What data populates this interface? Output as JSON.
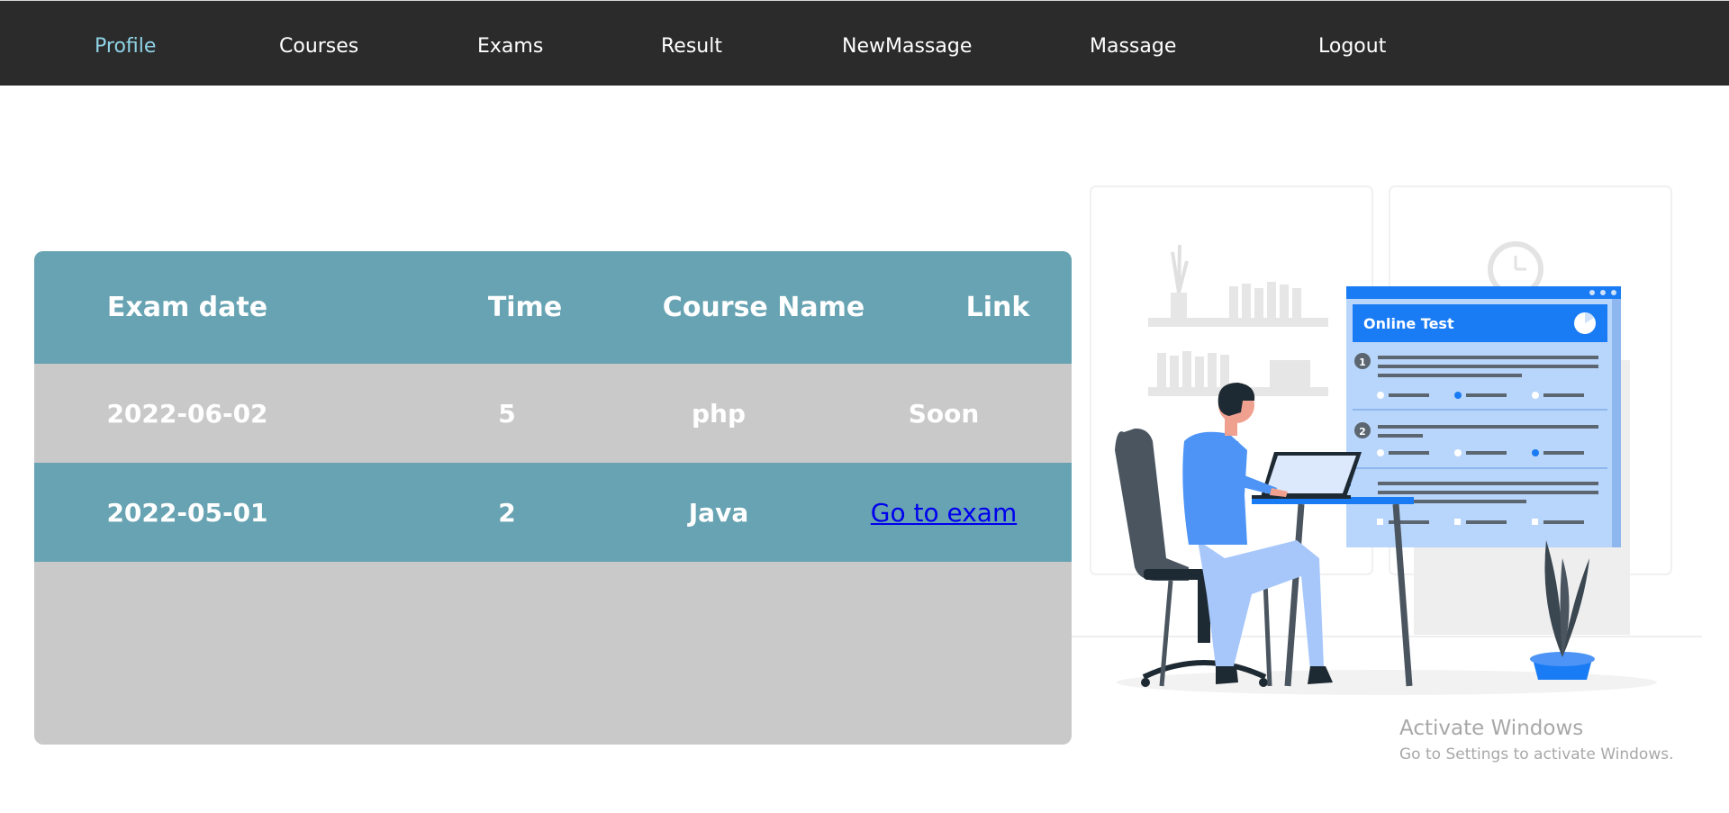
{
  "nav": {
    "items": [
      {
        "label": "Profile",
        "active": true
      },
      {
        "label": "Courses"
      },
      {
        "label": "Exams"
      },
      {
        "label": "Result"
      },
      {
        "label": "NewMassage"
      },
      {
        "label": "Massage"
      },
      {
        "label": "Logout"
      }
    ]
  },
  "exams_table": {
    "headers": [
      "Exam date",
      "Time",
      "Course Name",
      "Link"
    ],
    "rows": [
      {
        "date": "2022-06-02",
        "time": "5",
        "course": "php",
        "link": "Soon"
      },
      {
        "date": "2022-05-01",
        "time": "2",
        "course": "Java",
        "link": "Go to exam"
      }
    ]
  },
  "illustration": {
    "panel_title": "Online Test",
    "question_numbers": [
      "1",
      "2"
    ]
  },
  "watermark": {
    "title": "Activate Windows",
    "subtitle": "Go to Settings to activate Windows."
  },
  "colors": {
    "navbar": "#2b2b2b",
    "nav_active": "#8fd3e6",
    "table_teal": "#67a3b2",
    "table_gray": "#c9c9c9",
    "accent_blue": "#1a7cf4"
  }
}
